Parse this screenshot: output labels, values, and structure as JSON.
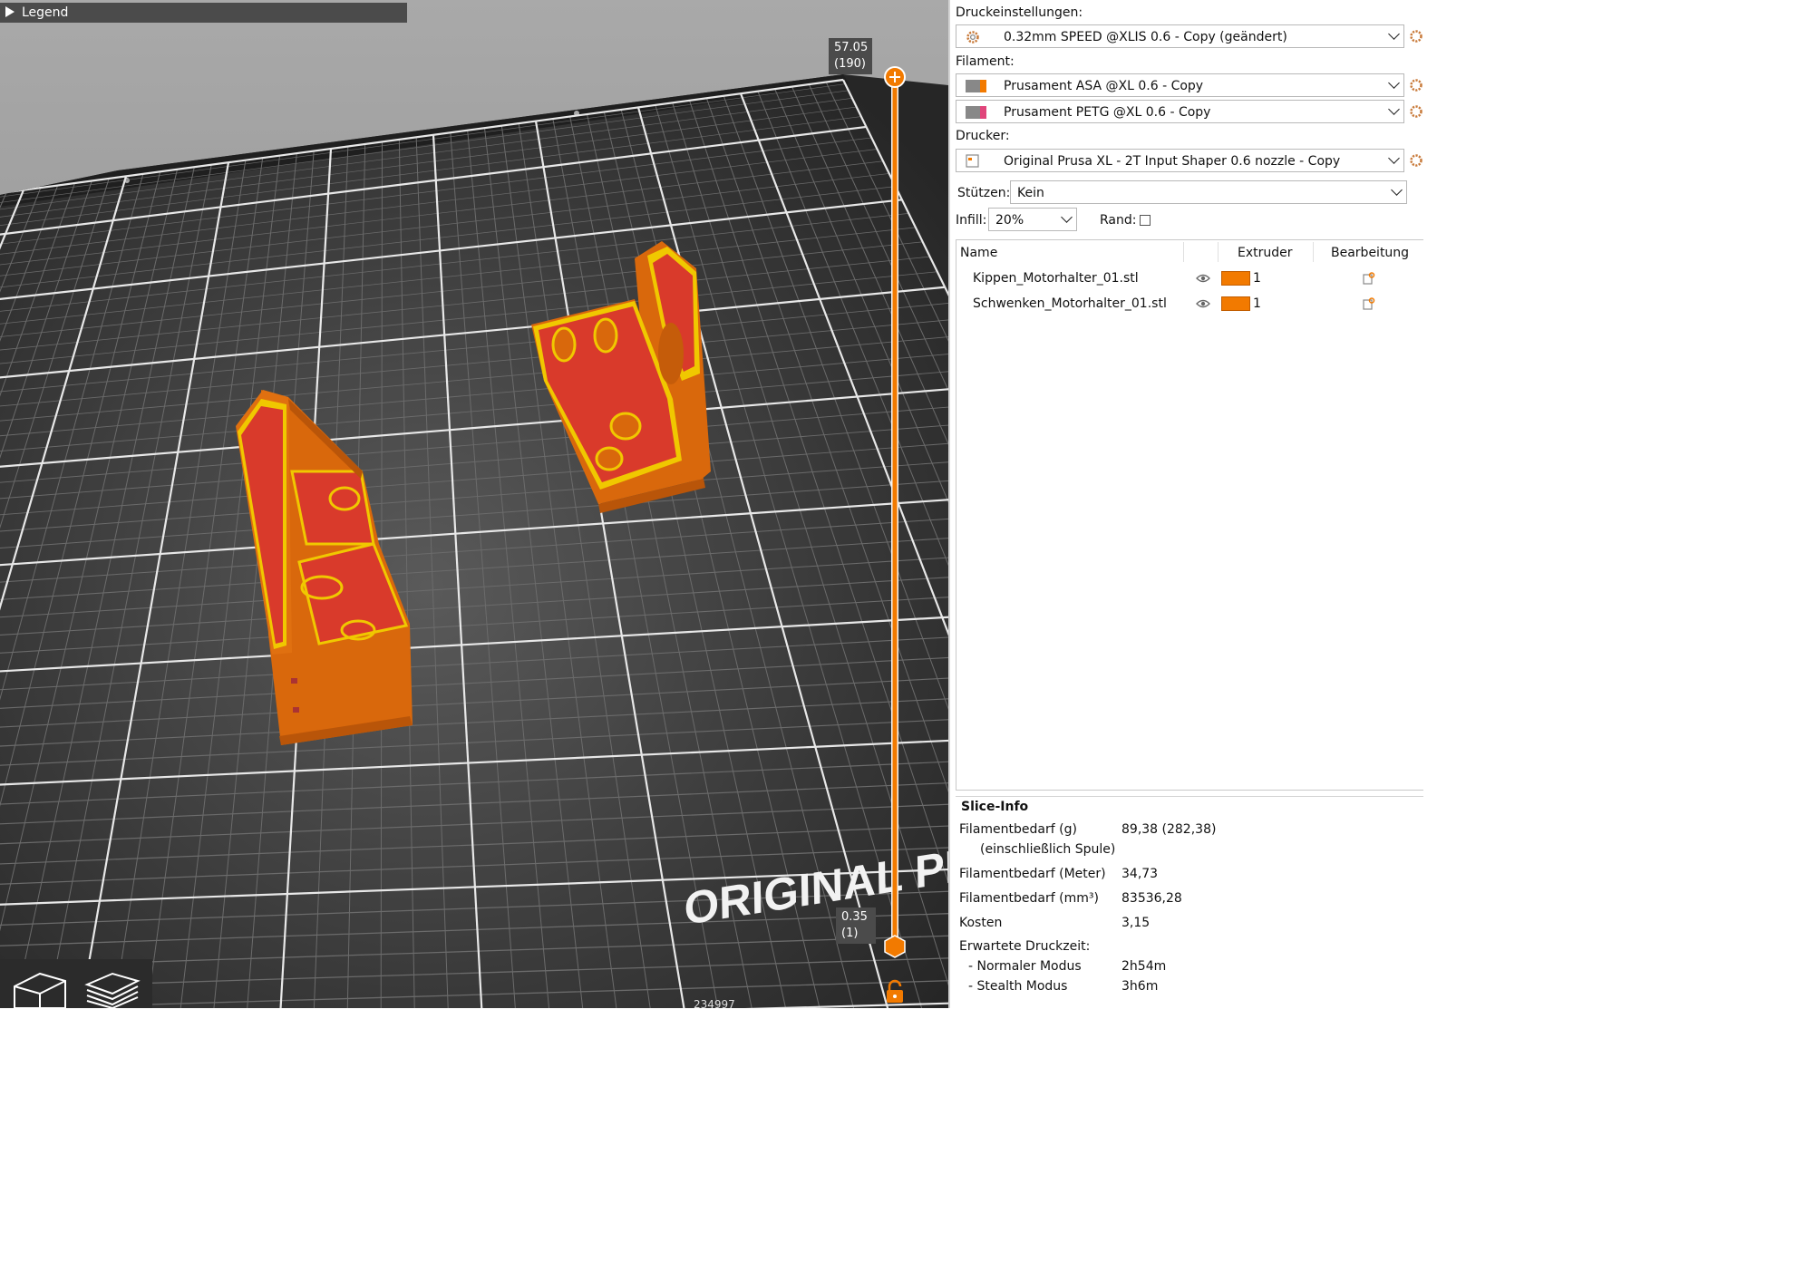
{
  "viewport": {
    "legend_label": "Legend",
    "slider_top_value": "57.05",
    "slider_top_layer": "(190)",
    "slider_bottom_value": "0.35",
    "slider_bottom_layer": "(1)",
    "bed_brand_text": "ORIGINAL PR",
    "bottom_counter": "234997"
  },
  "sidebar": {
    "print_settings_label": "Druckeinstellungen:",
    "print_settings_value": "0.32mm SPEED @XLIS 0.6 - Copy (geändert)",
    "filament_label": "Filament:",
    "filaments": [
      {
        "name": "Prusament ASA @XL 0.6 - Copy",
        "color": "#f27a00"
      },
      {
        "name": "Prusament PETG @XL 0.6 - Copy",
        "color": "#e0457b"
      }
    ],
    "printer_label": "Drucker:",
    "printer_value": "Original Prusa XL - 2T Input Shaper 0.6 nozzle - Copy",
    "supports_label": "Stützen:",
    "supports_value": "Kein",
    "infill_label": "Infill:",
    "infill_value": "20%",
    "brim_label": "Rand:",
    "brim_checked": false
  },
  "objects": {
    "columns": [
      "Name",
      "Extruder",
      "Bearbeitung"
    ],
    "rows": [
      {
        "name": "Kippen_Motorhalter_01.stl",
        "extruder": "1",
        "color": "#f27a00"
      },
      {
        "name": "Schwenken_Motorhalter_01.stl",
        "extruder": "1",
        "color": "#f27a00"
      }
    ]
  },
  "slice_info": {
    "title": "Slice-Info",
    "filament_g_label": "Filamentbedarf (g)",
    "filament_g_sub": "(einschließlich Spule)",
    "filament_g_value": "89,38 (282,38)",
    "filament_m_label": "Filamentbedarf (Meter)",
    "filament_m_value": "34,73",
    "filament_mm3_label": "Filamentbedarf (mm³)",
    "filament_mm3_value": "83536,28",
    "cost_label": "Kosten",
    "cost_value": "3,15",
    "print_time_label": "Erwartete Druckzeit:",
    "normal_mode_label": "- Normaler Modus",
    "normal_mode_value": "2h54m",
    "stealth_mode_label": "- Stealth Modus",
    "stealth_mode_value": "3h6m"
  },
  "colors": {
    "accent": "#f27a00",
    "model_top": "#d93a2b",
    "perimeter": "#f0d000",
    "bed": "#333333"
  }
}
